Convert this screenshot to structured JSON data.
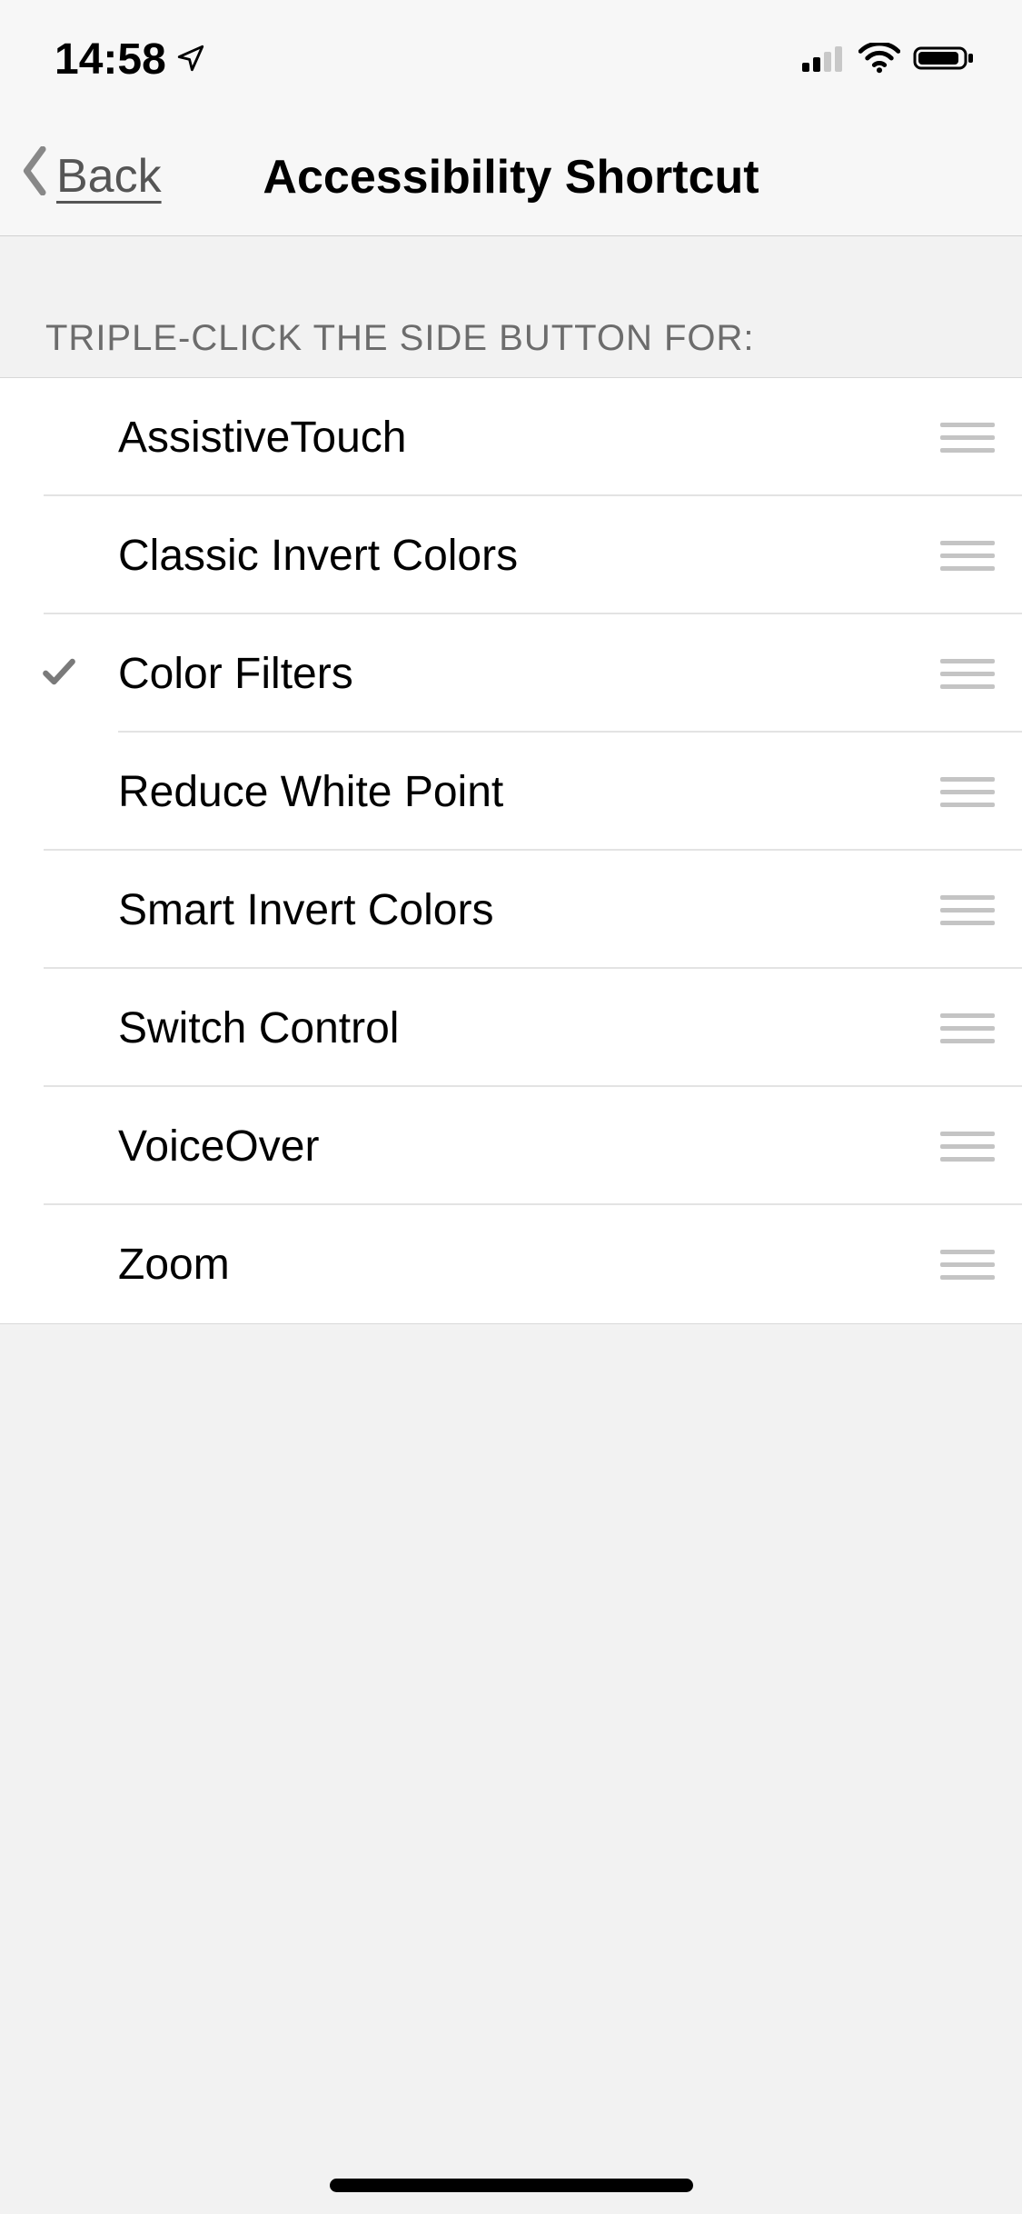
{
  "status": {
    "time": "14:58"
  },
  "nav": {
    "back_label": "Back",
    "title": "Accessibility Shortcut"
  },
  "section": {
    "header": "TRIPLE-CLICK THE SIDE BUTTON FOR:"
  },
  "rows": [
    {
      "label": "AssistiveTouch",
      "checked": false
    },
    {
      "label": "Classic Invert Colors",
      "checked": false
    },
    {
      "label": "Color Filters",
      "checked": true
    },
    {
      "label": "Reduce White Point",
      "checked": false
    },
    {
      "label": "Smart Invert Colors",
      "checked": false
    },
    {
      "label": "Switch Control",
      "checked": false
    },
    {
      "label": "VoiceOver",
      "checked": false
    },
    {
      "label": "Zoom",
      "checked": false
    }
  ]
}
